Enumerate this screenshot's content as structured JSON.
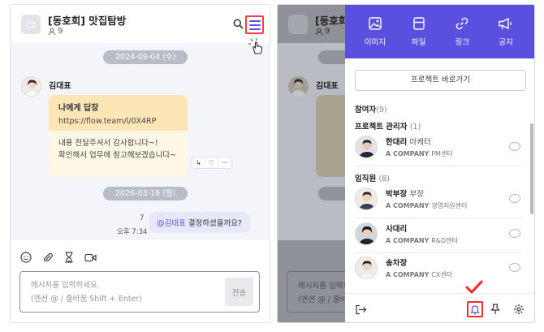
{
  "left_panel": {
    "header": {
      "room_title": "[동호회] 맛집탐방",
      "member_count": "9"
    },
    "dates": [
      "2024-09-04 (수)",
      "2026-03-16 (월)"
    ],
    "message1": {
      "sender": "김대표",
      "card_title": "나에게 답장",
      "card_link": "https://flow.team/l/0X4RP",
      "body_line1": "내용 전달주셔서 감사합니다~!",
      "body_line2": "확인해서 업무에 참고해보겠습니다~"
    },
    "message2": {
      "unread": "7",
      "time": "오후 7:34",
      "mention": "@김대표",
      "text": " 결정하셨을까요?"
    },
    "composer": {
      "placeholder_line1": "메시지를 입력하세요.",
      "placeholder_line2": "(멘션 @ / 줄바꿈 Shift + Enter)",
      "send_label": "전송"
    }
  },
  "right_panel": {
    "background_room_title": "[동호회",
    "background_member_count": "9",
    "background_sender": "김대표",
    "background_date": "2026-03-1",
    "background_placeholder_line1": "메시지를 입력하",
    "background_placeholder_line2": "(멘션 @ / 줄바",
    "drawer": {
      "tabs": [
        {
          "label": "이미지",
          "icon": "image-icon"
        },
        {
          "label": "파일",
          "icon": "file-icon"
        },
        {
          "label": "링크",
          "icon": "link-icon"
        },
        {
          "label": "공지",
          "icon": "megaphone-icon"
        }
      ],
      "project_button": "프로젝트 바로가기",
      "participants_label": "참여자",
      "participants_count": "(9)",
      "admins_label": "프로젝트 관리자",
      "admins_count": "(1)",
      "admins": [
        {
          "name": "한대리",
          "role": "마케터",
          "company": "A COMPANY",
          "dept": "PM센터"
        }
      ],
      "staff_label": "임직원",
      "staff_count": "(8)",
      "staff": [
        {
          "name": "박부장",
          "role": "부장",
          "company": "A COMPANY",
          "dept": "경영지원센터"
        },
        {
          "name": "사대리",
          "role": "",
          "company": "A COMPANY",
          "dept": "R&D센터"
        },
        {
          "name": "송차장",
          "role": "",
          "company": "A COMPANY",
          "dept": "CX센터"
        }
      ]
    }
  },
  "colors": {
    "brand": "#5b4fe0",
    "highlight": "#ff3b3b",
    "card_header": "#fde6b6",
    "card_body": "#fff7e6",
    "bubble": "#e8e8fb"
  }
}
